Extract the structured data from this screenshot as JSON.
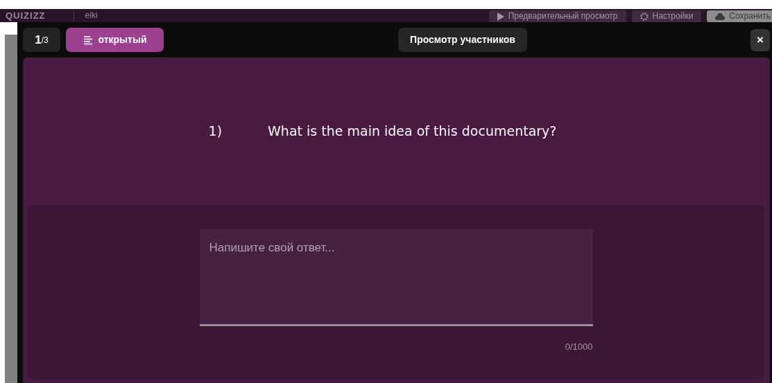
{
  "background_bar": {
    "logo": "QUIZIZZ",
    "title": "eiki",
    "buttons": [
      {
        "label": "Предварительный просмотр",
        "kind": "preview"
      },
      {
        "label": "Настройки",
        "kind": "settings"
      },
      {
        "label": "Сохранить",
        "kind": "save"
      }
    ]
  },
  "question_counter": {
    "current": "1",
    "total": "/3"
  },
  "question_type": {
    "label": "открытый"
  },
  "preview_button": {
    "label": "Просмотр участников"
  },
  "close_button": {
    "label": "×"
  },
  "question": {
    "number": "1)",
    "text": "What is the main idea of this documentary?"
  },
  "answer": {
    "placeholder": "Напишите свой ответ...",
    "counter": "0/1000"
  }
}
